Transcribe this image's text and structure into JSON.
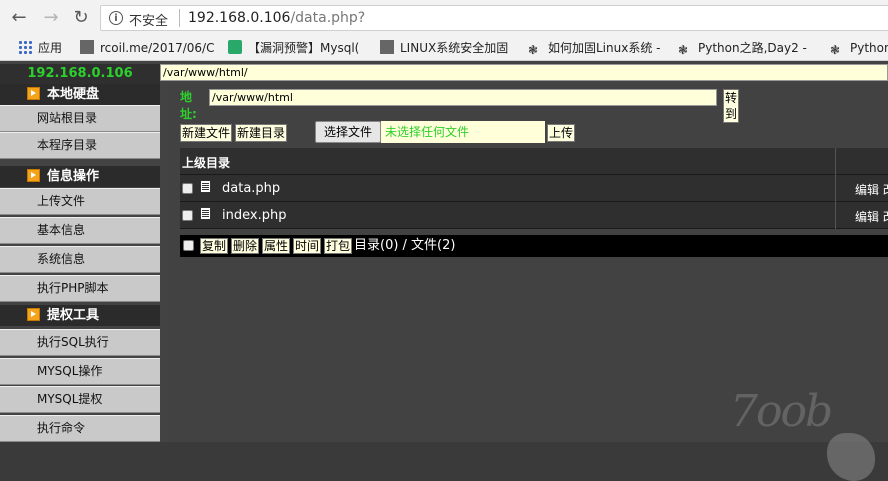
{
  "browser": {
    "security_label": "不安全",
    "url_host": "192.168.0.106",
    "url_path": "/data.php?",
    "bookmarks": [
      {
        "label": "应用"
      },
      {
        "label": "rcoil.me/2017/06/C"
      },
      {
        "label": "【漏洞预警】Mysql("
      },
      {
        "label": "LINUX系统安全加固"
      },
      {
        "label": "如何加固Linux系统 -"
      },
      {
        "label": "Python之路,Day2 -"
      },
      {
        "label": "Python"
      }
    ]
  },
  "shell": {
    "server_ip": "192.168.0.106",
    "current_path": "/var/www/html/",
    "sidebar": {
      "sections": [
        {
          "title": "本地硬盘",
          "items": [
            "网站根目录",
            "本程序目录"
          ]
        },
        {
          "title": "信息操作",
          "items": [
            "上传文件",
            "基本信息",
            "系统信息",
            "执行PHP脚本"
          ]
        },
        {
          "title": "提权工具",
          "items": [
            "执行SQL执行",
            "MYSQL操作",
            "MYSQL提权",
            "执行命令"
          ]
        }
      ]
    },
    "address_label": "地址:",
    "address_value": "/var/www/html",
    "goto_label": "转到",
    "new_file_label": "新建文件",
    "new_dir_label": "新建目录",
    "choose_file_label": "选择文件",
    "no_file_label": "未选择任何文件",
    "upload_label": "上传",
    "parent_dir_label": "上级目录",
    "files": [
      {
        "name": "data.php",
        "actions": "编辑 改"
      },
      {
        "name": "index.php",
        "actions": "编辑 改"
      }
    ],
    "bulk_actions": [
      "复制",
      "删除",
      "属性",
      "时间",
      "打包"
    ],
    "summary": "目录(0) / 文件(2)"
  },
  "watermark": "7oob",
  "colors": {
    "green": "#2cd12c",
    "yellow_input": "#ffffd9",
    "sidebar_item": "#c9c9c9"
  }
}
